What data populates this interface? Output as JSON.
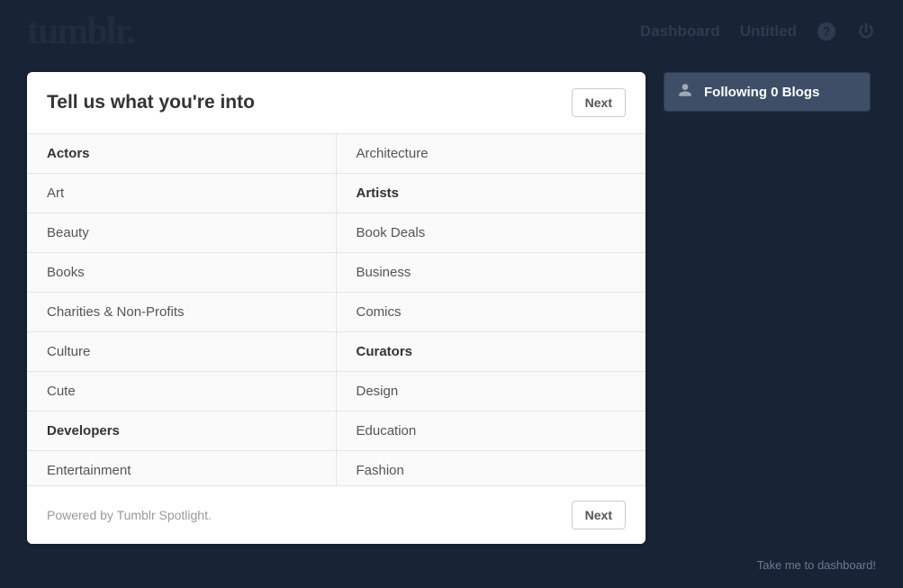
{
  "header": {
    "logo": "tumblr.",
    "nav": {
      "dashboard": "Dashboard",
      "untitled": "Untitled"
    }
  },
  "modal": {
    "title": "Tell us what you're into",
    "next_label": "Next",
    "footer_text": "Powered by Tumblr Spotlight.",
    "footer_next_label": "Next",
    "categories": [
      {
        "label": "Actors",
        "bold": true
      },
      {
        "label": "Architecture",
        "bold": false
      },
      {
        "label": "Art",
        "bold": false
      },
      {
        "label": "Artists",
        "bold": true
      },
      {
        "label": "Beauty",
        "bold": false
      },
      {
        "label": "Book Deals",
        "bold": false
      },
      {
        "label": "Books",
        "bold": false
      },
      {
        "label": "Business",
        "bold": false
      },
      {
        "label": "Charities & Non-Profits",
        "bold": false
      },
      {
        "label": "Comics",
        "bold": false
      },
      {
        "label": "Culture",
        "bold": false
      },
      {
        "label": "Curators",
        "bold": true
      },
      {
        "label": "Cute",
        "bold": false
      },
      {
        "label": "Design",
        "bold": false
      },
      {
        "label": "Developers",
        "bold": true
      },
      {
        "label": "Education",
        "bold": false
      },
      {
        "label": "Entertainment",
        "bold": false
      },
      {
        "label": "Fashion",
        "bold": false
      }
    ]
  },
  "sidebar": {
    "following_label": "Following 0 Blogs"
  },
  "bottom_link": "Take me to dashboard!"
}
